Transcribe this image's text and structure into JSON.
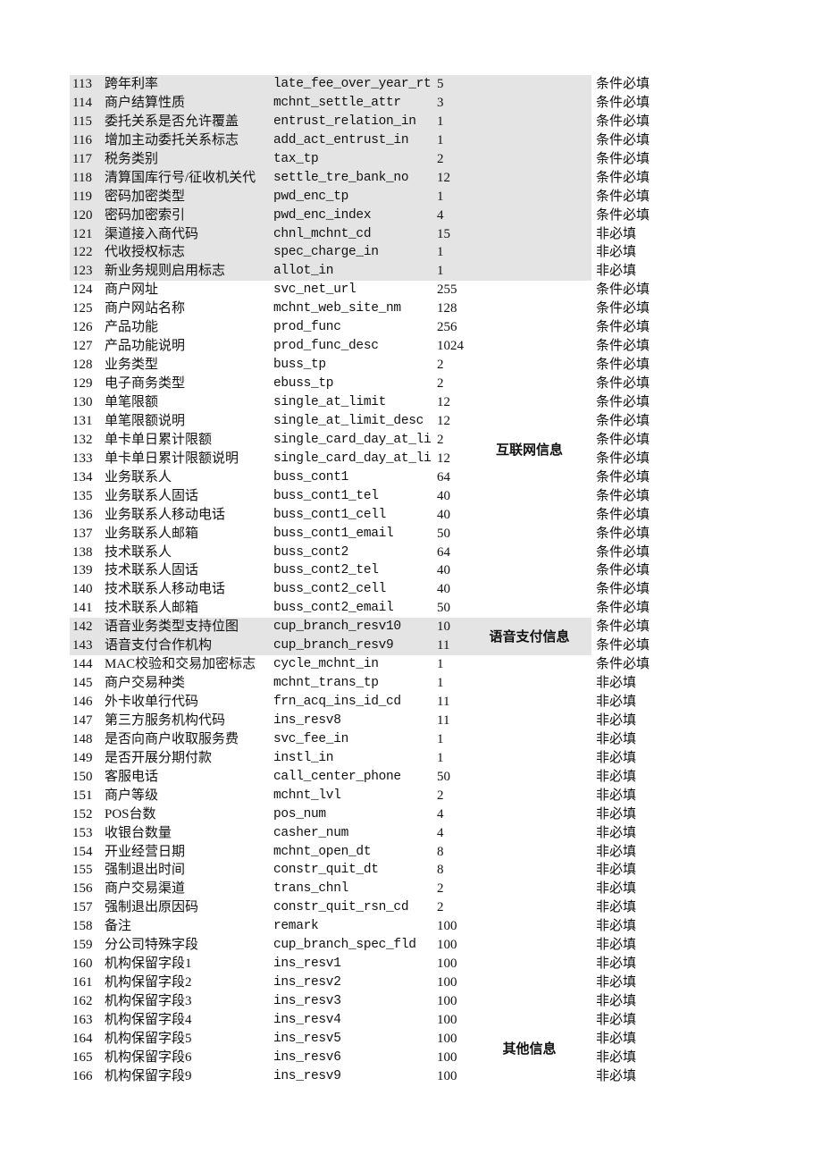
{
  "rows": [
    [
      "113",
      "跨年利率",
      "late_fee_over_year_rt",
      "5",
      "条件必填"
    ],
    [
      "114",
      "商户结算性质",
      "mchnt_settle_attr",
      "3",
      "条件必填"
    ],
    [
      "115",
      "委托关系是否允许覆盖",
      "entrust_relation_in",
      "1",
      "条件必填"
    ],
    [
      "116",
      "增加主动委托关系标志",
      "add_act_entrust_in",
      "1",
      "条件必填"
    ],
    [
      "117",
      "税务类别",
      "tax_tp",
      "2",
      "条件必填"
    ],
    [
      "118",
      "清算国库行号/征收机关代",
      "settle_tre_bank_no",
      "12",
      "条件必填"
    ],
    [
      "119",
      "密码加密类型",
      "pwd_enc_tp",
      "1",
      "条件必填"
    ],
    [
      "120",
      "密码加密索引",
      "pwd_enc_index",
      "4",
      "条件必填"
    ],
    [
      "121",
      "渠道接入商代码",
      "chnl_mchnt_cd",
      "15",
      "非必填"
    ],
    [
      "122",
      "代收授权标志",
      "spec_charge_in",
      "1",
      "非必填"
    ],
    [
      "123",
      "新业务规则启用标志",
      "allot_in",
      "1",
      "非必填"
    ],
    [
      "124",
      "商户网址",
      "svc_net_url",
      "255",
      "条件必填"
    ],
    [
      "125",
      "商户网站名称",
      "mchnt_web_site_nm",
      "128",
      "条件必填"
    ],
    [
      "126",
      "产品功能",
      "prod_func",
      "256",
      "条件必填"
    ],
    [
      "127",
      "产品功能说明",
      "prod_func_desc",
      "1024",
      "条件必填"
    ],
    [
      "128",
      "业务类型",
      "buss_tp",
      "2",
      "条件必填"
    ],
    [
      "129",
      "电子商务类型",
      "ebuss_tp",
      "2",
      "条件必填"
    ],
    [
      "130",
      "单笔限额",
      "single_at_limit",
      "12",
      "条件必填"
    ],
    [
      "131",
      "单笔限额说明",
      "single_at_limit_desc",
      "12",
      "条件必填"
    ],
    [
      "132",
      "单卡单日累计限额",
      "single_card_day_at_li",
      "2",
      "条件必填"
    ],
    [
      "133",
      "单卡单日累计限额说明",
      "single_card_day_at_li",
      "12",
      "条件必填"
    ],
    [
      "134",
      "业务联系人",
      "buss_cont1",
      "64",
      "条件必填"
    ],
    [
      "135",
      "业务联系人固话",
      "buss_cont1_tel",
      "40",
      "条件必填"
    ],
    [
      "136",
      "业务联系人移动电话",
      "buss_cont1_cell",
      "40",
      "条件必填"
    ],
    [
      "137",
      "业务联系人邮箱",
      "buss_cont1_email",
      "50",
      "条件必填"
    ],
    [
      "138",
      "技术联系人",
      "buss_cont2",
      "64",
      "条件必填"
    ],
    [
      "139",
      "技术联系人固话",
      "buss_cont2_tel",
      "40",
      "条件必填"
    ],
    [
      "140",
      "技术联系人移动电话",
      "buss_cont2_cell",
      "40",
      "条件必填"
    ],
    [
      "141",
      "技术联系人邮箱",
      "buss_cont2_email",
      "50",
      "条件必填"
    ],
    [
      "142",
      "语音业务类型支持位图",
      "cup_branch_resv10",
      "10",
      "条件必填"
    ],
    [
      "143",
      "语音支付合作机构",
      "cup_branch_resv9",
      "11",
      "条件必填"
    ],
    [
      "144",
      "MAC校验和交易加密标志",
      "cycle_mchnt_in",
      "1",
      "条件必填"
    ],
    [
      "145",
      "商户交易种类",
      "mchnt_trans_tp",
      "1",
      "非必填"
    ],
    [
      "146",
      "外卡收单行代码",
      "frn_acq_ins_id_cd",
      "11",
      "非必填"
    ],
    [
      "147",
      "第三方服务机构代码",
      "ins_resv8",
      "11",
      "非必填"
    ],
    [
      "148",
      "是否向商户收取服务费",
      "svc_fee_in",
      "1",
      "非必填"
    ],
    [
      "149",
      "是否开展分期付款",
      "instl_in",
      "1",
      "非必填"
    ],
    [
      "150",
      "客服电话",
      "call_center_phone",
      "50",
      "非必填"
    ],
    [
      "151",
      "商户等级",
      "mchnt_lvl",
      "2",
      "非必填"
    ],
    [
      "152",
      "POS台数",
      "pos_num",
      "4",
      "非必填"
    ],
    [
      "153",
      "收银台数量",
      "casher_num",
      "4",
      "非必填"
    ],
    [
      "154",
      "开业经营日期",
      "mchnt_open_dt",
      "8",
      "非必填"
    ],
    [
      "155",
      "强制退出时间",
      "constr_quit_dt",
      "8",
      "非必填"
    ],
    [
      "156",
      "商户交易渠道",
      "trans_chnl",
      "2",
      "非必填"
    ],
    [
      "157",
      "强制退出原因码",
      "constr_quit_rsn_cd",
      "2",
      "非必填"
    ],
    [
      "158",
      "备注",
      "remark",
      "100",
      "非必填"
    ],
    [
      "159",
      "分公司特殊字段",
      "cup_branch_spec_fld",
      "100",
      "非必填"
    ],
    [
      "160",
      "机构保留字段1",
      "ins_resv1",
      "100",
      "非必填"
    ],
    [
      "161",
      "机构保留字段2",
      "ins_resv2",
      "100",
      "非必填"
    ],
    [
      "162",
      "机构保留字段3",
      "ins_resv3",
      "100",
      "非必填"
    ],
    [
      "163",
      "机构保留字段4",
      "ins_resv4",
      "100",
      "非必填"
    ],
    [
      "164",
      "机构保留字段5",
      "ins_resv5",
      "100",
      "非必填"
    ],
    [
      "165",
      "机构保留字段6",
      "ins_resv6",
      "100",
      "非必填"
    ],
    [
      "166",
      "机构保留字段9",
      "ins_resv9",
      "100",
      "非必填"
    ]
  ],
  "sections": [
    {
      "label": "互联网信息",
      "center_row": "132/133"
    },
    {
      "label": "语音支付信息",
      "center_row": "142/143"
    },
    {
      "label": "其他信息",
      "center_row": "164/165"
    }
  ],
  "shading_color": "#e4e4e4",
  "shaded_rows": [
    [
      "113",
      "123"
    ],
    [
      "142",
      "143"
    ]
  ]
}
